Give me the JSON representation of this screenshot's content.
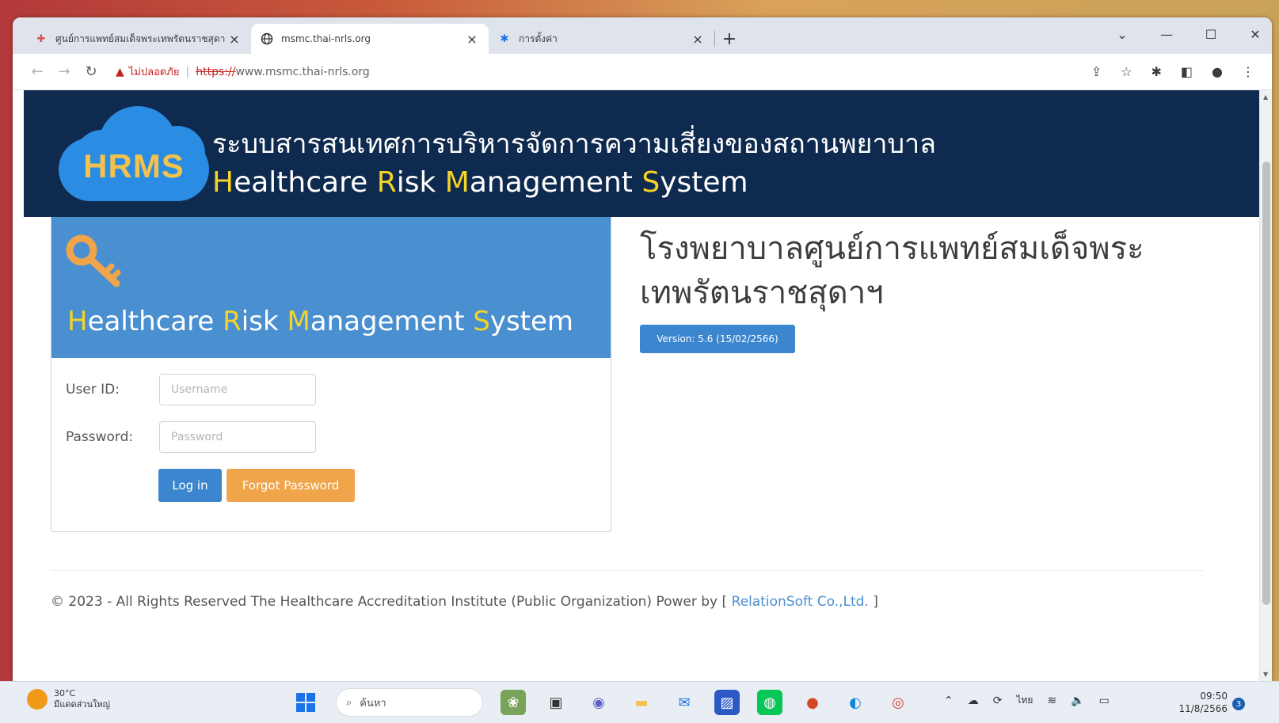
{
  "browser": {
    "tabs": [
      {
        "title": "ศูนย์การแพทย์สมเด็จพระเทพรัตนราชสุดา",
        "icon": "hospital-favicon"
      },
      {
        "title": "msmc.thai-nrls.org",
        "icon": "globe-icon"
      },
      {
        "title": "การตั้งค่า",
        "icon": "gear-icon"
      }
    ],
    "security_label": "ไม่ปลอดภัย",
    "url_scheme": "https://",
    "url_host": "www.msmc.thai-nrls.org",
    "new_tab": "+"
  },
  "header": {
    "logo_text": "HRMS",
    "thai_title": "ระบบสารสนเทศการบริหารจัดการความเสี่ยงของสถานพยาบาล",
    "en_title_parts": [
      "H",
      "ealthcare ",
      "R",
      "isk ",
      "M",
      "anagement ",
      "S",
      "ystem"
    ],
    "colors": {
      "bg": "#0f2a4f",
      "highlight": "#f5d327",
      "cloud": "#2a8ce2",
      "logo": "#f2c14e"
    }
  },
  "login": {
    "title_parts": [
      "H",
      "ealthcare ",
      "R",
      "isk ",
      "M",
      "anagement ",
      "S",
      "ystem"
    ],
    "user_label": "User ID:",
    "user_placeholder": "Username",
    "password_label": "Password:",
    "password_placeholder": "Password",
    "login_button": "Log in",
    "forgot_button": "Forgot Password",
    "colors": {
      "panel": "#4a8fd0",
      "login_btn": "#3b86cf",
      "forgot_btn": "#f0a54a"
    }
  },
  "hospital": {
    "name": "โรงพยาบาลศูนย์การแพทย์สมเด็จพระเทพรัตนราชสุดาฯ",
    "version": "Version: 5.6 (15/02/2566)"
  },
  "footer": {
    "text": "© 2023 - All Rights Reserved The Healthcare Accreditation Institute (Public Organization) Power by [ ",
    "link": "RelationSoft Co.,Ltd.",
    "close": " ]"
  },
  "taskbar": {
    "weather_temp": "30°C",
    "weather_desc": "มีแดดส่วนใหญ่",
    "search_placeholder": "ค้นหา",
    "lang": "ไทย",
    "time": "09:50",
    "date": "11/8/2566",
    "notification_count": "3"
  }
}
